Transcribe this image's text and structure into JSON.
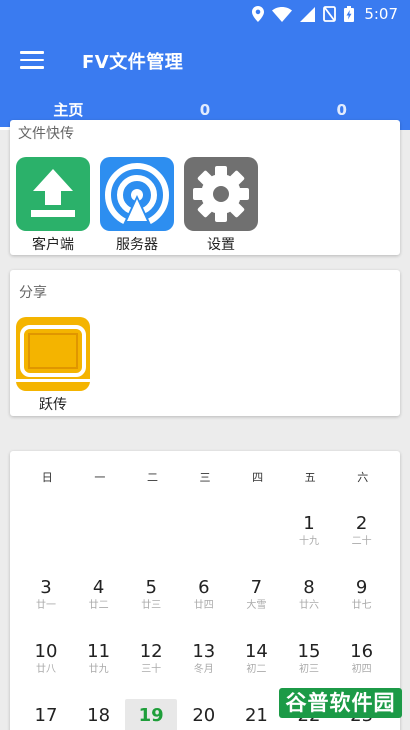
{
  "status": {
    "time": "5:07"
  },
  "appbar": {
    "title": "FV文件管理"
  },
  "tabs": [
    {
      "label": "主页"
    },
    {
      "label": "0"
    },
    {
      "label": "0"
    }
  ],
  "card_transfer": {
    "title_clipped": "文件快传",
    "items": [
      {
        "label": "客户端"
      },
      {
        "label": "服务器"
      },
      {
        "label": "设置"
      }
    ]
  },
  "card_share": {
    "title": "分享",
    "items": [
      {
        "label": "跃传"
      }
    ]
  },
  "calendar": {
    "weekdays": [
      "日",
      "一",
      "二",
      "三",
      "四",
      "五",
      "六"
    ],
    "rows": [
      [
        null,
        null,
        null,
        null,
        null,
        {
          "day": "1",
          "lunar": "十九"
        },
        {
          "day": "2",
          "lunar": "二十"
        }
      ],
      [
        {
          "day": "3",
          "lunar": "廿一"
        },
        {
          "day": "4",
          "lunar": "廿二"
        },
        {
          "day": "5",
          "lunar": "廿三"
        },
        {
          "day": "6",
          "lunar": "廿四"
        },
        {
          "day": "7",
          "lunar": "大雪"
        },
        {
          "day": "8",
          "lunar": "廿六"
        },
        {
          "day": "9",
          "lunar": "廿七"
        }
      ],
      [
        {
          "day": "10",
          "lunar": "廿八"
        },
        {
          "day": "11",
          "lunar": "廿九"
        },
        {
          "day": "12",
          "lunar": "三十"
        },
        {
          "day": "13",
          "lunar": "冬月"
        },
        {
          "day": "14",
          "lunar": "初二"
        },
        {
          "day": "15",
          "lunar": "初三"
        },
        {
          "day": "16",
          "lunar": "初四"
        }
      ],
      [
        {
          "day": "17",
          "lunar": ""
        },
        {
          "day": "18",
          "lunar": ""
        },
        {
          "day": "19",
          "lunar": "",
          "today": true
        },
        {
          "day": "20",
          "lunar": ""
        },
        {
          "day": "21",
          "lunar": ""
        },
        {
          "day": "22",
          "lunar": ""
        },
        {
          "day": "23",
          "lunar": ""
        }
      ]
    ]
  },
  "watermark": {
    "text": "谷普软件园"
  },
  "colors": {
    "primary": "#3a7bf0",
    "green": "#2bb16a",
    "blue": "#2d8ef0",
    "gray": "#707070",
    "yellow": "#f4b400",
    "today": "#1e9e3a"
  }
}
